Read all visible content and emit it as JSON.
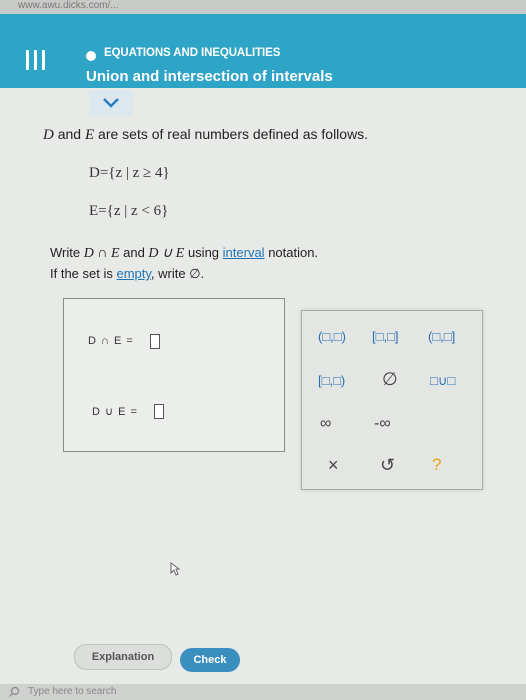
{
  "browser": {
    "url_fragment": "www.awu.dicks.com/..."
  },
  "header": {
    "topic": "EQUATIONS AND INEQUALITIES",
    "lesson": "Union and intersection of intervals"
  },
  "question": {
    "intro_prefix": "D",
    "intro_mid": " and ",
    "intro_e": "E",
    "intro_suffix": " are sets of real numbers defined as follows.",
    "set_d": "D={z | z ≥ 4}",
    "set_e": "E={z | z < 6}",
    "instruction_1_prefix": "Write ",
    "instruction_1_int": "D ∩ E",
    "instruction_1_and": " and ",
    "instruction_1_union": "D ∪ E",
    "instruction_1_using": " using ",
    "instruction_1_link": "interval",
    "instruction_1_suffix": " notation.",
    "instruction_2_prefix": "If the set is ",
    "instruction_2_link": "empty",
    "instruction_2_suffix": ", write ∅."
  },
  "answers": {
    "intersection_label": "D ∩ E =",
    "union_label": "D ∪ E ="
  },
  "palette": {
    "open_open": "(□,□)",
    "closed_closed": "[□,□]",
    "open_closed": "(□,□]",
    "closed_open": "[□,□)",
    "empty_set": "∅",
    "union": "□∪□",
    "infinity": "∞",
    "neg_infinity": "-∞",
    "clear": "×",
    "undo": "↺",
    "help": "?"
  },
  "footer": {
    "explanation": "Explanation",
    "check": "Check"
  },
  "taskbar": {
    "search_placeholder": "Type here to search"
  },
  "colors": {
    "header": "#2ea4c6",
    "link": "#1f73b7",
    "check_button": "#3a8fbf"
  }
}
